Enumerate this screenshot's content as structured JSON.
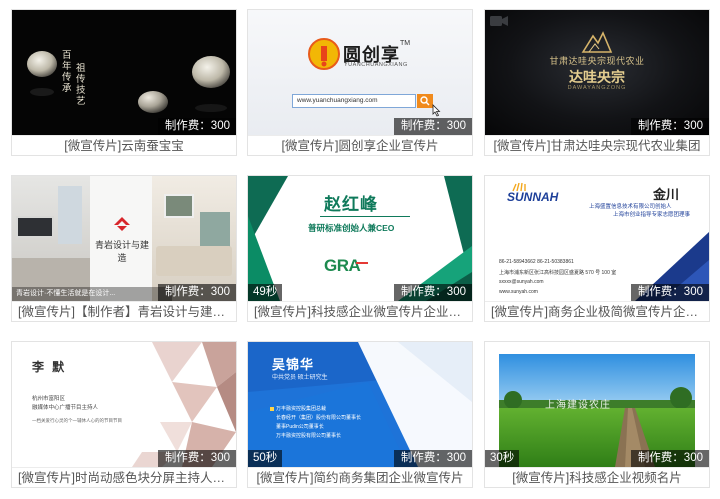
{
  "fee_label": "制作费：300",
  "cards": [
    {
      "title": "[微宣传片]云南蚕宝宝",
      "duration": "",
      "thumb_text": [
        "百年传承",
        "祖传技艺"
      ]
    },
    {
      "title": "[微宣传片]圆创享企业宣传片",
      "duration": "",
      "thumb_text": [
        "圆创享",
        "TM",
        "YUANCHUANGXIANG",
        "www.yuanchuangxiang.com"
      ]
    },
    {
      "title": "[微宣传片]甘肃达哇央宗现代农业集团",
      "duration": "",
      "thumb_text": [
        "甘肃达哇央宗现代农业",
        "达哇央宗",
        "DAWAYANGZONG"
      ]
    },
    {
      "title": "[微宣传片]【制作者】青岩设计与建造...",
      "duration": "",
      "thumb_text": [
        "青岩设计与建造",
        "青岩设计·不懂生活就是在设计..."
      ]
    },
    {
      "title": "[微宣传片]科技感企业微宣传片企业名片",
      "duration": "49秒",
      "thumb_text": [
        "赵红峰",
        "普研标准创始人兼CEO",
        "GRA"
      ]
    },
    {
      "title": "[微宣传片]商务企业极简微宣传片企业...",
      "duration": "",
      "thumb_text": [
        "SUNNAH",
        "金川",
        "上海盛置信息技术有限公司创始人",
        "上海市创业指导专家志愿团理事",
        "86-21-58943662   86-21-50383861",
        "上海市浦东新区张江高科技园区盛夏路 570 号 100 室",
        "sxxxx@sunyah.com",
        "www.sunyah.com"
      ]
    },
    {
      "title": "[微宣传片]时尚动感色块分屏主持人视...",
      "duration": "",
      "thumb_text": [
        "李 默",
        "杭州市富阳区",
        "融媒体中心广播节目主持人",
        "一档关爱行心灵的个一辅休人心的的节目节目"
      ]
    },
    {
      "title": "[微宣传片]简约商务集团企业微宣传片",
      "duration": "50秒",
      "thumb_text": [
        "吴锦华",
        "中共党员  硕士研究生",
        "万丰融资控股集团总裁",
        "长春经开（集团）股份有限公司董事长",
        "董事Pudin公司董事长",
        "万丰融资控股有限公司董事长"
      ]
    },
    {
      "title": "[微宣传片]科技感企业视频名片",
      "duration": "30秒",
      "thumb_text": [
        "上海建设农庄"
      ]
    }
  ]
}
